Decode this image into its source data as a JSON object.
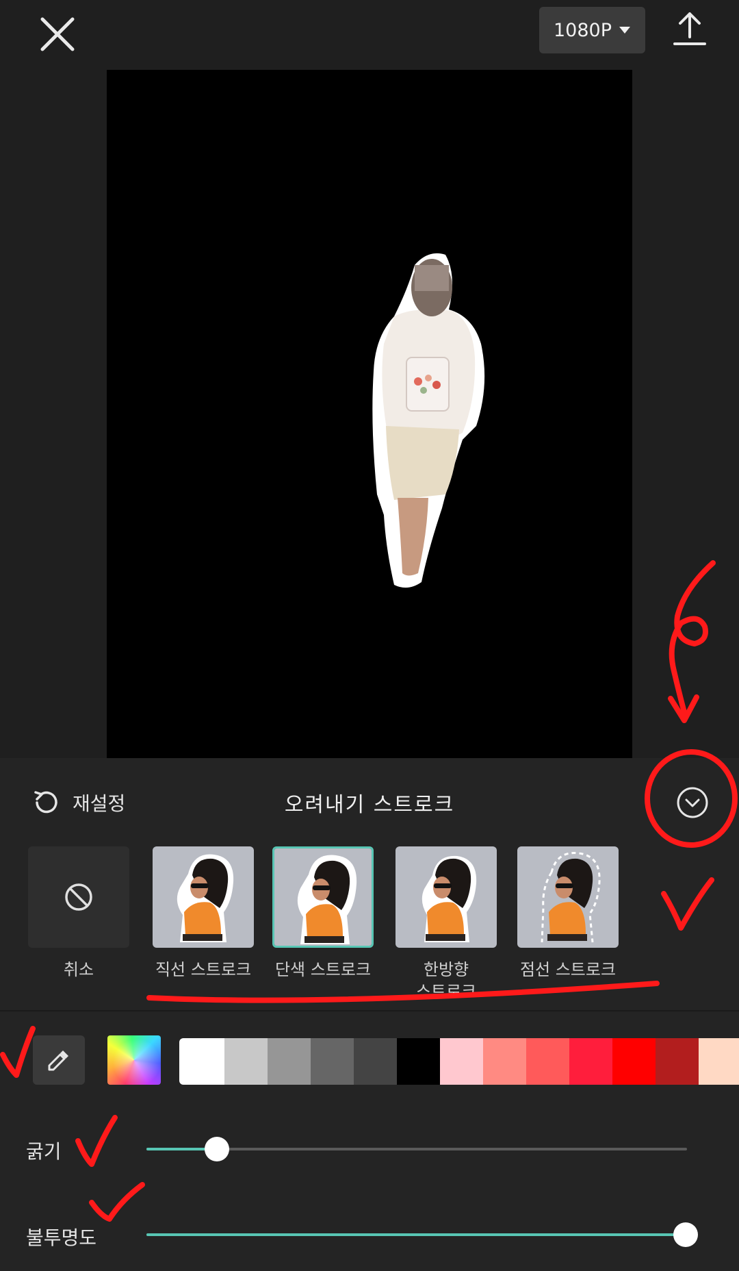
{
  "toolbar": {
    "resolution_label": "1080P",
    "close_icon": "close-icon",
    "export_icon": "export-icon"
  },
  "panel": {
    "reset_label": "재설정",
    "title": "오려내기 스트로크",
    "collapse_icon": "chevron-down-circle-icon"
  },
  "styles": [
    {
      "label": "취소",
      "icon": "no-icon",
      "selected": false
    },
    {
      "label": "직선 스트로크",
      "selected": false
    },
    {
      "label": "단색 스트로크",
      "selected": true
    },
    {
      "label": "한방향\n스트로크",
      "selected": false
    },
    {
      "label": "점선 스트로크",
      "selected": false
    }
  ],
  "colors": {
    "eyedropper_icon": "eyedropper-icon",
    "custom_color_icon": "color-wheel-icon",
    "swatches": [
      "#ffffff",
      "#c8c8c8",
      "#969696",
      "#666666",
      "#444444",
      "#000000",
      "#ffc8cf",
      "#ff8a82",
      "#ff5a5a",
      "#ff1e3c",
      "#ff0000",
      "#b21e1e",
      "#ffd9c4"
    ]
  },
  "sliders": {
    "thickness": {
      "label": "굵기",
      "value": 0.13
    },
    "opacity": {
      "label": "불투명도",
      "value": 1.0
    }
  },
  "accent_color": "#58c6b4",
  "annotation_color": "#ff1a1a"
}
